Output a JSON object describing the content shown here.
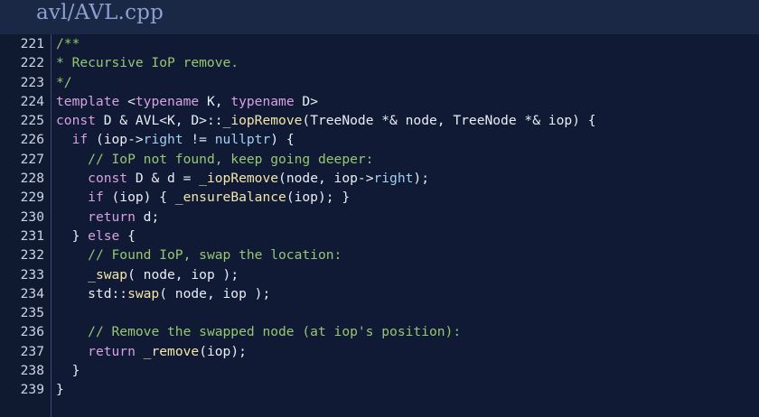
{
  "file_title": "avl/AVL.cpp",
  "colors": {
    "background": "#101a34",
    "comment": "#97c770",
    "keyword": "#d7a0e0",
    "function": "#f2e6a8",
    "member": "#9fd1f2",
    "text": "#e9edf7",
    "line_number": "#cdd3e6"
  },
  "lines": [
    {
      "num": "221",
      "tokens": [
        {
          "t": "/**",
          "k": "comment"
        }
      ]
    },
    {
      "num": "222",
      "tokens": [
        {
          "t": "* Recursive IoP remove.",
          "k": "comment"
        }
      ]
    },
    {
      "num": "223",
      "tokens": [
        {
          "t": "*/",
          "k": "comment"
        }
      ]
    },
    {
      "num": "224",
      "tokens": [
        {
          "t": "template",
          "k": "keyword"
        },
        {
          "t": " <",
          "k": "text"
        },
        {
          "t": "typename",
          "k": "keyword"
        },
        {
          "t": " K, ",
          "k": "text"
        },
        {
          "t": "typename",
          "k": "keyword"
        },
        {
          "t": " D>",
          "k": "text"
        }
      ]
    },
    {
      "num": "225",
      "tokens": [
        {
          "t": "const",
          "k": "keyword"
        },
        {
          "t": " D & AVL<K, D>::",
          "k": "text"
        },
        {
          "t": "_iopRemove",
          "k": "func"
        },
        {
          "t": "(TreeNode *& node, TreeNode *& iop) {",
          "k": "text"
        }
      ]
    },
    {
      "num": "226",
      "tokens": [
        {
          "t": "  ",
          "k": "text"
        },
        {
          "t": "if",
          "k": "keyword"
        },
        {
          "t": " (iop->",
          "k": "text"
        },
        {
          "t": "right",
          "k": "member"
        },
        {
          "t": " != ",
          "k": "text"
        },
        {
          "t": "nullptr",
          "k": "member"
        },
        {
          "t": ") {",
          "k": "text"
        }
      ]
    },
    {
      "num": "227",
      "tokens": [
        {
          "t": "    ",
          "k": "text"
        },
        {
          "t": "// IoP not found, keep going deeper:",
          "k": "comment"
        }
      ]
    },
    {
      "num": "228",
      "tokens": [
        {
          "t": "    ",
          "k": "text"
        },
        {
          "t": "const",
          "k": "keyword"
        },
        {
          "t": " D & d = ",
          "k": "text"
        },
        {
          "t": "_iopRemove",
          "k": "func"
        },
        {
          "t": "(node, iop->",
          "k": "text"
        },
        {
          "t": "right",
          "k": "member"
        },
        {
          "t": ");",
          "k": "text"
        }
      ]
    },
    {
      "num": "229",
      "tokens": [
        {
          "t": "    ",
          "k": "text"
        },
        {
          "t": "if",
          "k": "keyword"
        },
        {
          "t": " (iop) { ",
          "k": "text"
        },
        {
          "t": "_ensureBalance",
          "k": "func"
        },
        {
          "t": "(iop); }",
          "k": "text"
        }
      ]
    },
    {
      "num": "230",
      "tokens": [
        {
          "t": "    ",
          "k": "text"
        },
        {
          "t": "return",
          "k": "keyword"
        },
        {
          "t": " d;",
          "k": "text"
        }
      ]
    },
    {
      "num": "231",
      "tokens": [
        {
          "t": "  } ",
          "k": "text"
        },
        {
          "t": "else",
          "k": "keyword"
        },
        {
          "t": " {",
          "k": "text"
        }
      ]
    },
    {
      "num": "232",
      "tokens": [
        {
          "t": "    ",
          "k": "text"
        },
        {
          "t": "// Found IoP, swap the location:",
          "k": "comment"
        }
      ]
    },
    {
      "num": "233",
      "tokens": [
        {
          "t": "    ",
          "k": "text"
        },
        {
          "t": "_swap",
          "k": "func"
        },
        {
          "t": "( node, iop );",
          "k": "text"
        }
      ]
    },
    {
      "num": "234",
      "tokens": [
        {
          "t": "    std::",
          "k": "text"
        },
        {
          "t": "swap",
          "k": "func"
        },
        {
          "t": "( node, iop );",
          "k": "text"
        }
      ]
    },
    {
      "num": "235",
      "tokens": []
    },
    {
      "num": "236",
      "tokens": [
        {
          "t": "    ",
          "k": "text"
        },
        {
          "t": "// Remove the swapped node (at iop's position):",
          "k": "comment"
        }
      ]
    },
    {
      "num": "237",
      "tokens": [
        {
          "t": "    ",
          "k": "text"
        },
        {
          "t": "return",
          "k": "keyword"
        },
        {
          "t": " ",
          "k": "text"
        },
        {
          "t": "_remove",
          "k": "func"
        },
        {
          "t": "(iop);",
          "k": "text"
        }
      ]
    },
    {
      "num": "238",
      "tokens": [
        {
          "t": "  }",
          "k": "text"
        }
      ]
    },
    {
      "num": "239",
      "tokens": [
        {
          "t": "}",
          "k": "text"
        }
      ]
    }
  ]
}
